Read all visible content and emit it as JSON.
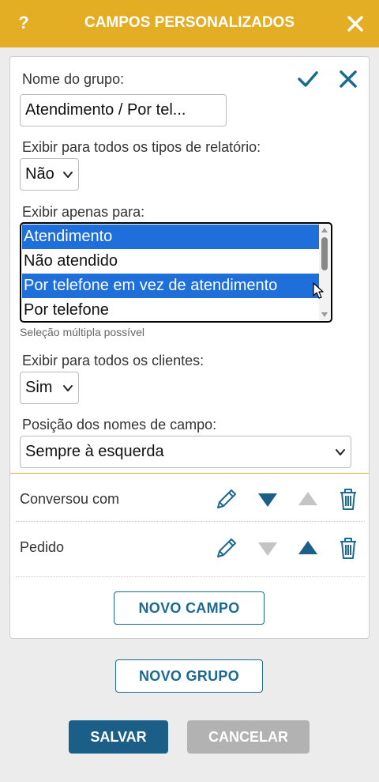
{
  "header": {
    "help_label": "?",
    "title": "CAMPOS PERSONALIZADOS",
    "color": "#e3ad24"
  },
  "group_form": {
    "group_name_label": "Nome do grupo:",
    "group_name_value": "Atendimento / Por tel...",
    "show_all_report_types_label": "Exibir para todos os tipos de relatório:",
    "show_all_report_types_value": "Não",
    "show_only_for_label": "Exibir apenas para:",
    "show_only_for_options": [
      {
        "label": "Atendimento",
        "selected": true
      },
      {
        "label": "Não atendido",
        "selected": false
      },
      {
        "label": "Por telefone em vez de atendimento",
        "selected": true
      },
      {
        "label": "Por telefone",
        "selected": false
      }
    ],
    "multi_select_hint": "Seleção múltipla possível",
    "show_all_clients_label": "Exibir para todos os clientes:",
    "show_all_clients_value": "Sim",
    "field_name_position_label": "Posição dos nomes de campo:",
    "field_name_position_value": "Sempre à esquerda"
  },
  "fields": [
    {
      "name": "Conversou com",
      "down_enabled": true,
      "up_enabled": false
    },
    {
      "name": "Pedido",
      "down_enabled": false,
      "up_enabled": true
    }
  ],
  "buttons": {
    "new_field": "NOVO CAMPO",
    "new_group": "NOVO GRUPO",
    "save": "SALVAR",
    "cancel": "CANCELAR"
  },
  "colors": {
    "accent": "#1b6a8f",
    "selection": "#1e6fd9",
    "disabled": "#b2b2b2"
  }
}
